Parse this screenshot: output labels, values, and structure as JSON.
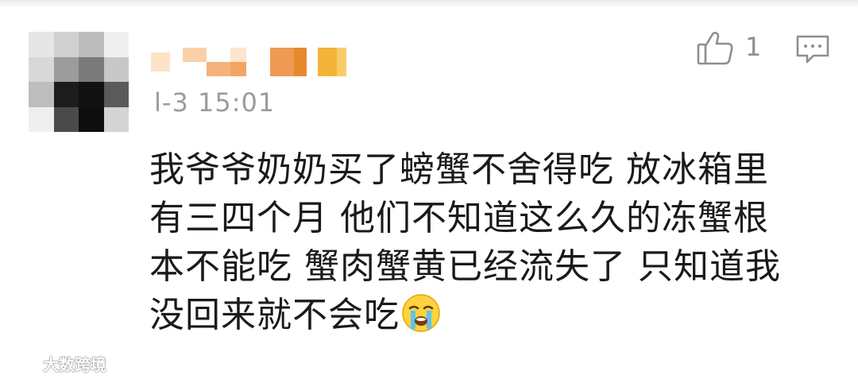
{
  "comment": {
    "timestamp": "l-3 15:01",
    "likes": "1",
    "text_lines": [
      "我爷爷奶奶买了螃蟹不舍得吃 放冰箱里",
      "有三四个月 他们不知道这么久的冻蟹根",
      "本不能吃 蟹肉蟹黄已经流失了 只知道我",
      "没回来就不会吃"
    ],
    "emoji": "crying-face-emoji"
  },
  "icons": {
    "like": "thumbs-up-icon",
    "reply": "comment-bubble-icon"
  },
  "watermark": {
    "text": "大数跨境",
    "logo": "watermark-logo"
  },
  "colors": {
    "text": "#1a1a1a",
    "meta": "#9b9b9b",
    "icon": "#8e8e8e",
    "username_orange": "#e9892e",
    "username_yellow": "#f3b43a"
  }
}
